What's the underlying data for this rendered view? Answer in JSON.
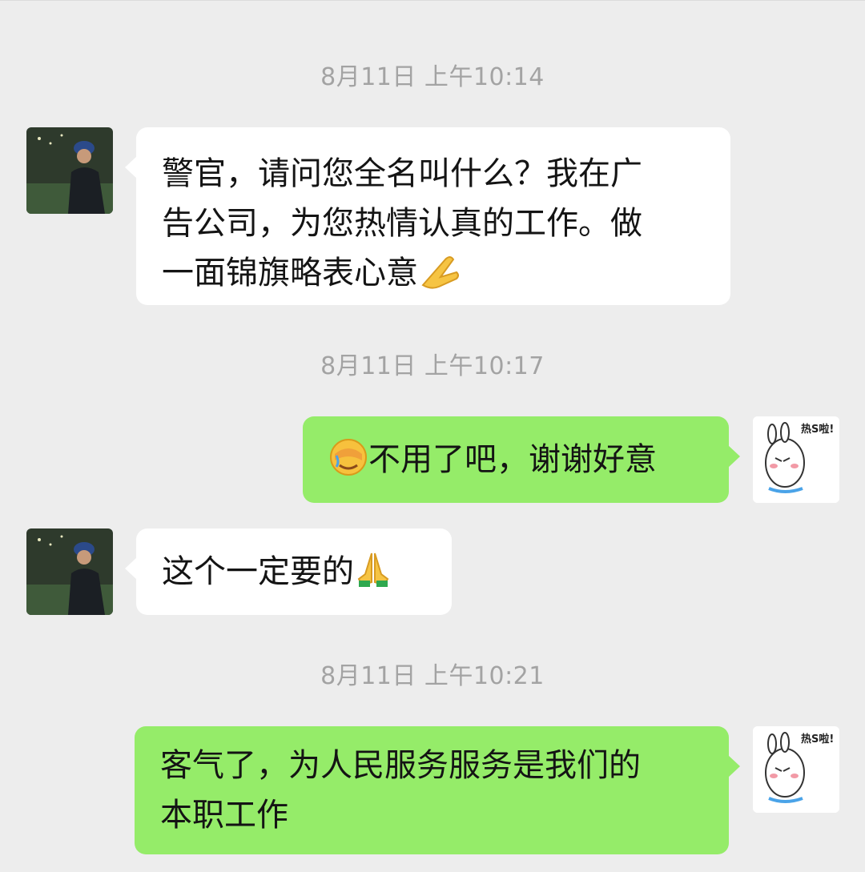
{
  "colors": {
    "background": "#ededed",
    "incoming_bubble": "#ffffff",
    "outgoing_bubble": "#95ec69",
    "timestamp_text": "#a3a3a3"
  },
  "messages": [
    {
      "timestamp": "8月11日  上午10:14",
      "sender": "other",
      "text": "警官，请问您全名叫什么？我在广\n告公司，为您热情认真的工作。做\n一面锦旗略表心意",
      "emoji": "folded-hands-emoji"
    },
    {
      "timestamp": "8月11日  上午10:17",
      "sender": "self",
      "text": "不用了吧，谢谢好意",
      "emoji": "facepalm-emoji",
      "sticker_text": "热S啦!"
    },
    {
      "sender": "other",
      "text": "这个一定要的",
      "emoji": "pray-emoji"
    },
    {
      "timestamp": "8月11日  上午10:21",
      "sender": "self",
      "text": "客气了，为人民服务服务是我们的\n本职工作",
      "sticker_text": "热S啦!"
    }
  ]
}
